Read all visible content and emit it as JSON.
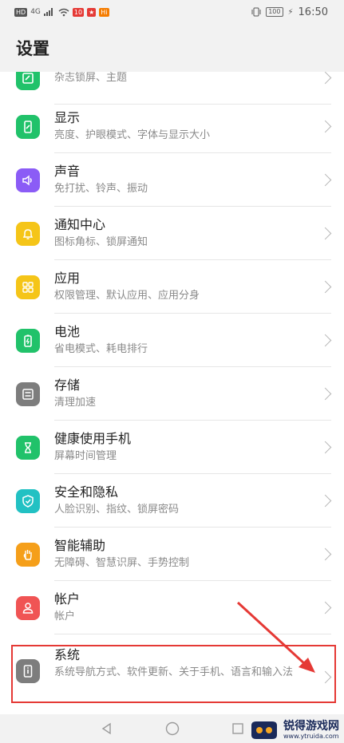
{
  "status_bar": {
    "left_chips": [
      "HD",
      "4G",
      "10",
      "Hi"
    ],
    "battery": "100",
    "time": "16:50"
  },
  "header": {
    "title": "设置"
  },
  "items": [
    {
      "title": "",
      "subtitle": "杂志锁屏、主题",
      "icon": "theme-icon",
      "color": "#2ecc71"
    },
    {
      "title": "显示",
      "subtitle": "亮度、护眼模式、字体与显示大小",
      "icon": "display-icon",
      "color": "#21c26a"
    },
    {
      "title": "声音",
      "subtitle": "免打扰、铃声、振动",
      "icon": "speaker-icon",
      "color": "#8b5cf6"
    },
    {
      "title": "通知中心",
      "subtitle": "图标角标、锁屏通知",
      "icon": "bell-icon",
      "color": "#f5c518"
    },
    {
      "title": "应用",
      "subtitle": "权限管理、默认应用、应用分身",
      "icon": "apps-grid-icon",
      "color": "#f5c518"
    },
    {
      "title": "电池",
      "subtitle": "省电模式、耗电排行",
      "icon": "battery-icon",
      "color": "#21c26a"
    },
    {
      "title": "存储",
      "subtitle": "清理加速",
      "icon": "storage-icon",
      "color": "#7d7d7d"
    },
    {
      "title": "健康使用手机",
      "subtitle": "屏幕时间管理",
      "icon": "hourglass-icon",
      "color": "#21c26a"
    },
    {
      "title": "安全和隐私",
      "subtitle": "人脸识别、指纹、锁屏密码",
      "icon": "shield-icon",
      "color": "#22c1c3"
    },
    {
      "title": "智能辅助",
      "subtitle": "无障碍、智慧识屏、手势控制",
      "icon": "hand-icon",
      "color": "#f59f1a"
    },
    {
      "title": "帐户",
      "subtitle": "帐户",
      "icon": "user-icon",
      "color": "#f05454"
    },
    {
      "title": "系统",
      "subtitle": "系统导航方式、软件更新、关于手机、语言和输入法",
      "icon": "phone-info-icon",
      "color": "#7d7d7d"
    }
  ],
  "navbar": [
    "back-icon",
    "home-icon",
    "recents-icon"
  ],
  "watermark": {
    "title": "锐得游戏网",
    "url": "www.ytruida.com"
  },
  "annotation": {
    "highlight_color": "#e53935"
  }
}
